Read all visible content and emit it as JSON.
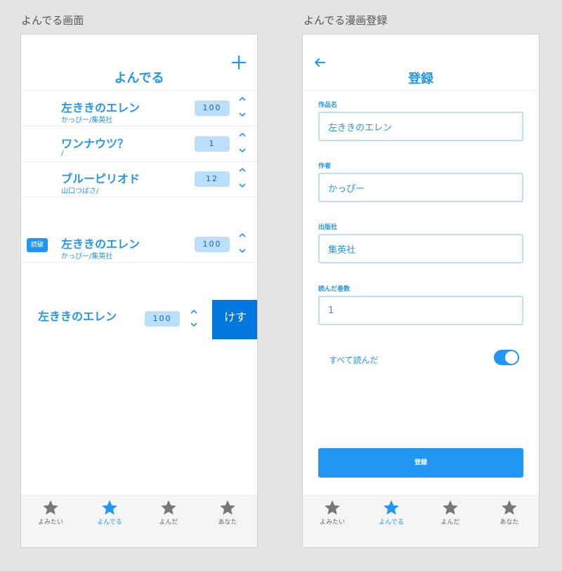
{
  "captions": {
    "left": "よんでる画面",
    "right": "よんでる漫画登録"
  },
  "list_screen": {
    "title": "よんでる",
    "add_icon": "plus-icon",
    "rows": [
      {
        "title": "左ききのエレン",
        "subtitle": "かっぴー/集英社",
        "count": "100"
      },
      {
        "title": "ワンナウツ？",
        "subtitle": "/",
        "count": "1"
      },
      {
        "title": "ブルーピリオド",
        "subtitle": "山口つばさ/",
        "count": "12"
      }
    ],
    "finished_row": {
      "badge": "読破",
      "title": "左ききのエレン",
      "subtitle": "かっぴー/集英社",
      "count": "100"
    },
    "swipe_row": {
      "title": "左ききのエレン",
      "count": "100",
      "delete_label": "けす"
    }
  },
  "register_screen": {
    "title": "登録",
    "back_icon": "arrow-left-icon",
    "fields": [
      {
        "label": "作品名",
        "value": "左ききのエレン"
      },
      {
        "label": "作者",
        "value": "かっぴー"
      },
      {
        "label": "出版社",
        "value": "集英社"
      },
      {
        "label": "読んだ巻数",
        "value": "1"
      }
    ],
    "toggle_label": "すべて読んだ",
    "toggle_on": true,
    "submit_label": "登録"
  },
  "tabs": [
    {
      "label": "よみたい",
      "icon": "star-icon"
    },
    {
      "label": "よんでる",
      "icon": "star-icon"
    },
    {
      "label": "よんだ",
      "icon": "star-icon"
    },
    {
      "label": "あなた",
      "icon": "star-icon"
    }
  ],
  "active_tab_index": 1,
  "colors": {
    "accent": "#2196f3",
    "accent_light": "#bbdefb",
    "delete": "#0277e0",
    "tab_inactive": "#777777",
    "background": "#e4e4e4"
  }
}
